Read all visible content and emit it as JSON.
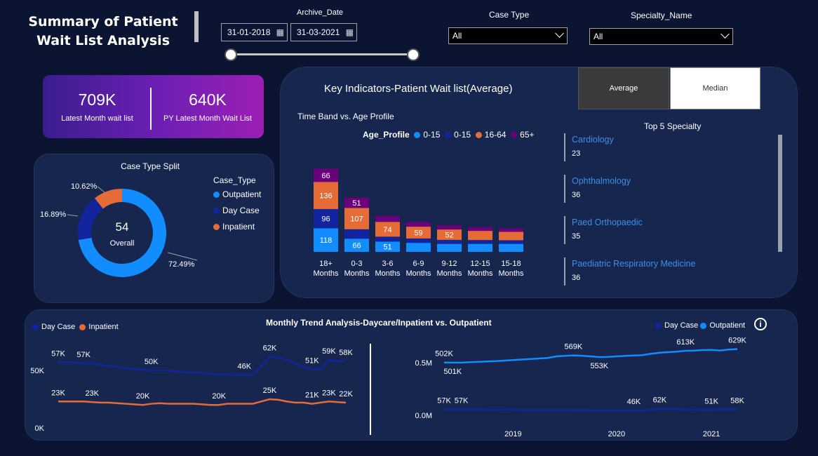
{
  "header": {
    "title": "Summary of Patient Wait List Analysis"
  },
  "filters": {
    "archive_label": "Archive_Date",
    "date_from": "31-01-2018",
    "date_to": "31-03-2021",
    "case_type_label": "Case Type",
    "case_type_value": "All",
    "specialty_label": "Specialty_Name",
    "specialty_value": "All"
  },
  "kpi": {
    "latest_value": "709K",
    "latest_caption": "Latest Month wait list",
    "py_value": "640K",
    "py_caption": "PY Latest Month Wait List"
  },
  "key_indicators": {
    "title": "Key Indicators-Patient Wait list(Average)",
    "average_button": "Average",
    "median_button": "Median",
    "time_band_title": "Time Band vs. Age Profile",
    "top5_title": "Top 5 Specialty",
    "specialties": [
      {
        "name": "Cardiology",
        "value": "23"
      },
      {
        "name": "Ophthalmology",
        "value": "36"
      },
      {
        "name": "Paed Orthopaedic",
        "value": "35"
      },
      {
        "name": "Paediatric Respiratory Medicine",
        "value": "36"
      }
    ]
  },
  "case_split": {
    "title": "Case Type Split",
    "center_value": "54",
    "center_caption": "Overall",
    "legend_title": "Case_Type",
    "legend": [
      "Outpatient",
      "Day Case",
      "Inpatient"
    ],
    "pct_outpatient": "72.49%",
    "pct_daycase": "16.89%",
    "pct_inpatient": "10.62%"
  },
  "trend": {
    "title": "Monthly Trend Analysis-Daycare/Inpatient vs. Outpatient",
    "left_legend": [
      "Day Case",
      "Inpatient"
    ],
    "right_legend": [
      "Day Case",
      "Outpatient"
    ],
    "info_icon": "info-icon"
  },
  "colors": {
    "outpatient": "#118dff",
    "daycase": "#12239e",
    "inpatient": "#e66c37",
    "plus65": "#6b007b",
    "panel": "#17264e",
    "kpi_gradient_start": "#3b1d8f",
    "kpi_gradient_end": "#9c1fb5"
  },
  "chart_data": [
    {
      "type": "bar",
      "title": "Time Band vs. Age Profile",
      "legend_title": "Age_Profile",
      "categories": [
        "18+ Months",
        "0-3 Months",
        "3-6 Months",
        "6-9 Months",
        "9-12 Months",
        "12-15 Months",
        "15-18 Months"
      ],
      "category_lines": [
        [
          "18+",
          "Months"
        ],
        [
          "0-3",
          "Months"
        ],
        [
          "3-6",
          "Months"
        ],
        [
          "6-9",
          "Months"
        ],
        [
          "9-12",
          "Months"
        ],
        [
          "12-15",
          "Months"
        ],
        [
          "15-18",
          "Months"
        ]
      ],
      "series": [
        {
          "name": "0-15",
          "color": "#118dff",
          "values": [
            118,
            66,
            51,
            45,
            40,
            40,
            40
          ],
          "labels": [
            "118",
            "66",
            "51",
            "",
            "",
            "",
            ""
          ]
        },
        {
          "name": "0-15",
          "color": "#12239e",
          "values": [
            96,
            47,
            25,
            22,
            20,
            19,
            18
          ],
          "labels": [
            "96",
            "",
            "",
            "",
            "",
            "",
            ""
          ]
        },
        {
          "name": "16-64",
          "color": "#e66c37",
          "values": [
            136,
            107,
            74,
            59,
            52,
            46,
            42
          ],
          "labels": [
            "136",
            "107",
            "74",
            "59",
            "52",
            "",
            ""
          ]
        },
        {
          "name": "65+",
          "color": "#6b007b",
          "values": [
            66,
            51,
            30,
            23,
            21,
            19,
            17
          ],
          "labels": [
            "66",
            "51",
            "",
            "",
            "",
            "",
            ""
          ]
        }
      ],
      "stacked": true
    },
    {
      "type": "pie",
      "title": "Case Type Split",
      "donut": true,
      "slices": [
        {
          "name": "Outpatient",
          "value": 72.49,
          "color": "#118dff"
        },
        {
          "name": "Day Case",
          "value": 16.89,
          "color": "#12239e"
        },
        {
          "name": "Inpatient",
          "value": 10.62,
          "color": "#e66c37"
        }
      ]
    },
    {
      "type": "line",
      "title": "Day Case / Inpatient",
      "ytick_labels": [
        "50K",
        "0K"
      ],
      "ytick_values": [
        50000,
        0
      ],
      "ylim": [
        0,
        75000
      ],
      "x_year_labels": [
        "2019",
        "2020",
        "2021"
      ],
      "x_year_index": [
        6,
        18,
        30
      ],
      "series": [
        {
          "name": "Day Case",
          "color": "#12239e",
          "values": [
            57000,
            57000,
            57000,
            56000,
            56000,
            55000,
            54000,
            53000,
            52000,
            51000,
            50500,
            50000,
            50000,
            50000,
            49000,
            48500,
            48000,
            48000,
            47000,
            46500,
            46500,
            46000,
            46000,
            46000,
            54000,
            62000,
            61000,
            59000,
            56000,
            53000,
            51000,
            51000,
            59000,
            58000,
            58000
          ],
          "labels": [
            [
              "57K",
              0
            ],
            [
              "57K",
              3
            ],
            [
              "50K",
              11
            ],
            [
              "46K",
              22
            ],
            [
              "62K",
              25
            ],
            [
              "51K",
              30
            ],
            [
              "59K",
              32
            ],
            [
              "58K",
              34
            ]
          ]
        },
        {
          "name": "Inpatient",
          "color": "#e66c37",
          "values": [
            23000,
            23000,
            23000,
            23000,
            22500,
            22000,
            22000,
            21500,
            21000,
            20500,
            20000,
            21000,
            21500,
            21000,
            21000,
            21000,
            21000,
            20500,
            20000,
            20000,
            21000,
            21000,
            21000,
            21000,
            23000,
            25000,
            24500,
            23000,
            22000,
            22000,
            21000,
            22000,
            23000,
            22500,
            22000
          ],
          "labels": [
            [
              "23K",
              0
            ],
            [
              "23K",
              4
            ],
            [
              "20K",
              10
            ],
            [
              "20K",
              19
            ],
            [
              "25K",
              25
            ],
            [
              "21K",
              30
            ],
            [
              "23K",
              32
            ],
            [
              "22K",
              34
            ]
          ]
        }
      ]
    },
    {
      "type": "line",
      "title": "Day Case / Outpatient",
      "ytick_labels": [
        "0.5M",
        "0.0M"
      ],
      "ytick_values": [
        500000,
        0
      ],
      "ylim": [
        0,
        700000
      ],
      "x_year_labels": [
        "2019",
        "2020",
        "2021"
      ],
      "x_year_index": [
        8,
        20,
        31
      ],
      "series": [
        {
          "name": "Outpatient",
          "color": "#118dff",
          "values": [
            502000,
            501000,
            501000,
            505000,
            508000,
            512000,
            515000,
            520000,
            525000,
            530000,
            535000,
            540000,
            545000,
            560000,
            565000,
            569000,
            566000,
            560000,
            553000,
            555000,
            560000,
            565000,
            568000,
            572000,
            585000,
            595000,
            600000,
            605000,
            613000,
            615000,
            620000,
            622000,
            616000,
            625000,
            629000
          ],
          "labels": [
            [
              "502K",
              0,
              "above"
            ],
            [
              "501K",
              1,
              "below"
            ],
            [
              "569K",
              15,
              "above"
            ],
            [
              "553K",
              18,
              "below"
            ],
            [
              "613K",
              28,
              "above"
            ],
            [
              "629K",
              34,
              "above"
            ]
          ]
        },
        {
          "name": "Day Case",
          "color": "#12239e",
          "values": [
            57000,
            57000,
            57000,
            56000,
            56000,
            55000,
            54000,
            53000,
            52000,
            51000,
            50500,
            50000,
            50000,
            50000,
            49000,
            48500,
            48000,
            48000,
            47000,
            46500,
            46500,
            46000,
            46000,
            46000,
            54000,
            62000,
            61000,
            59000,
            56000,
            53000,
            51000,
            51000,
            59000,
            58000,
            58000
          ],
          "labels": [
            [
              "57K",
              0,
              "above"
            ],
            [
              "57K",
              2,
              "above"
            ],
            [
              "46K",
              22,
              "above"
            ],
            [
              "62K",
              25,
              "above"
            ],
            [
              "51K",
              31,
              "above"
            ],
            [
              "58K",
              34,
              "above"
            ]
          ]
        }
      ]
    }
  ]
}
